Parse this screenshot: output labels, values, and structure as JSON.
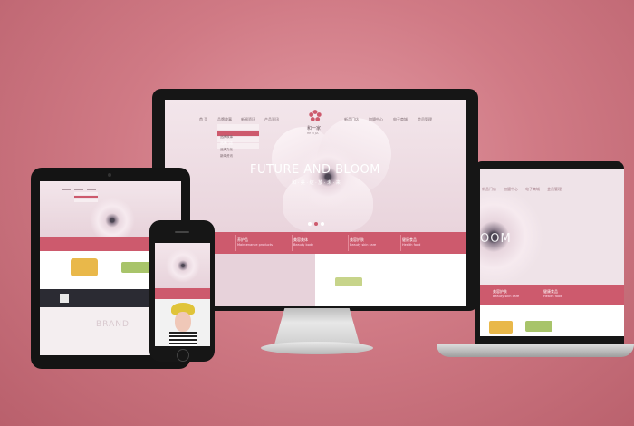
{
  "desktop": {
    "nav_left": [
      "首 页",
      "品牌故事",
      "新闻资讯",
      "产品资讯"
    ],
    "nav_right": [
      "新品门店",
      "加盟中心",
      "电子商城",
      "会员管理"
    ],
    "dropdown": [
      "品牌故事",
      "品牌门店",
      "品牌文化",
      "新闻资讯"
    ],
    "brand_name": "和一家",
    "brand_pinyin": "HE YI JIA",
    "hero_title": "FUTURE AND BLOOM",
    "hero_sub": "和 · 美 · 绽 · 放 · 未 · 来",
    "categories": [
      {
        "cn": "养护品",
        "en": "Maintenance products"
      },
      {
        "cn": "美容美体",
        "en": "Beauty body"
      },
      {
        "cn": "美容护肤",
        "en": "Beauty skin care"
      },
      {
        "cn": "健康食品",
        "en": "Health food"
      }
    ]
  },
  "laptop": {
    "nav": [
      "新品门店",
      "加盟中心",
      "电子商城",
      "会员管理"
    ],
    "hero_fragment": "OOM",
    "categories": [
      {
        "cn": "美容护肤",
        "en": "Beauty skin care"
      },
      {
        "cn": "健康食品",
        "en": "Health food"
      }
    ]
  },
  "tablet": {
    "brand_text": "BRAND"
  },
  "colors": {
    "accent": "#cd5a6d",
    "background": "#d07a85",
    "screen_bg": "#efe3e8"
  }
}
